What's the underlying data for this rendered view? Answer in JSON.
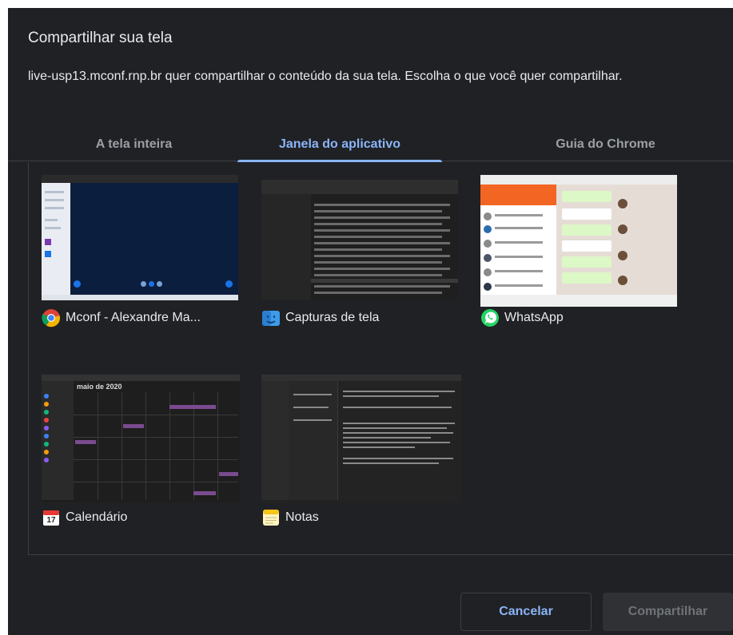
{
  "dialog": {
    "title": "Compartilhar sua tela",
    "description": "live-usp13.mconf.rnp.br quer compartilhar o conteúdo da sua tela. Escolha o que você quer compartilhar."
  },
  "tabs": [
    {
      "label": "A tela inteira",
      "active": false
    },
    {
      "label": "Janela do aplicativo",
      "active": true
    },
    {
      "label": "Guia do Chrome",
      "active": false
    }
  ],
  "windows": [
    {
      "label": "Mconf - Alexandre Ma...",
      "icon": "chrome-icon"
    },
    {
      "label": "Capturas de tela",
      "icon": "finder-folder-icon"
    },
    {
      "label": "WhatsApp",
      "icon": "whatsapp-icon"
    },
    {
      "label": "Calendário",
      "icon": "calendar-icon",
      "calendar_day": "17",
      "thumbnail_heading": "maio de 2020"
    },
    {
      "label": "Notas",
      "icon": "notes-icon"
    }
  ],
  "buttons": {
    "cancel": "Cancelar",
    "share": "Compartilhar"
  },
  "colors": {
    "background": "#202124",
    "accent": "#8ab4f8",
    "text": "#e8eaed",
    "muted": "#9aa0a6"
  }
}
